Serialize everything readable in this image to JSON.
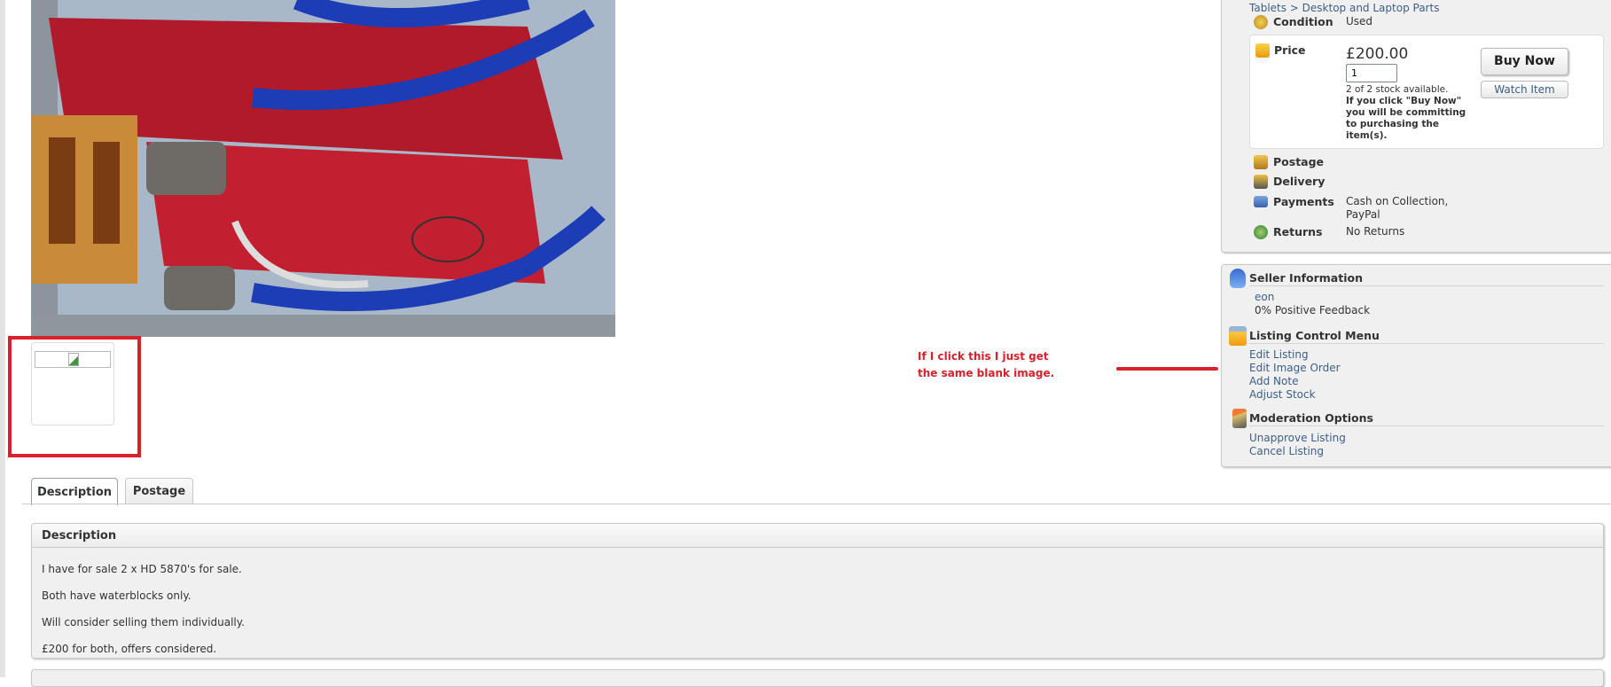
{
  "listing": {
    "breadcrumb_tail": "Tablets > Desktop and Laptop Parts",
    "condition_label": "Condition",
    "condition_value": "Used",
    "price_label": "Price",
    "price_value": "£200.00",
    "quantity_value": "1",
    "stock_text": "2 of 2 stock available.",
    "buy_warning": "If you click \"Buy Now\" you will be committing to purchasing the item(s).",
    "buy_now_label": "Buy Now",
    "watch_item_label": "Watch Item",
    "postage_label": "Postage",
    "delivery_label": "Delivery",
    "payments_label": "Payments",
    "payments_value_1": "Cash on Collection,",
    "payments_value_2": "PayPal",
    "returns_label": "Returns",
    "returns_value": "No Returns"
  },
  "seller": {
    "title": "Seller Information",
    "name": "eon",
    "feedback": "0% Positive Feedback"
  },
  "listing_control": {
    "title": "Listing Control Menu",
    "items": [
      "Edit Listing",
      "Edit Image Order",
      "Add Note",
      "Adjust Stock"
    ]
  },
  "moderation": {
    "title": "Moderation Options",
    "items": [
      "Unapprove Listing",
      "Cancel Listing"
    ]
  },
  "tabs": [
    {
      "label": "Description"
    },
    {
      "label": "Postage"
    }
  ],
  "description": {
    "title": "Description",
    "paragraphs": [
      "I have for sale 2 x HD 5870's for sale.",
      "Both have waterblocks only.",
      "Will consider selling them individually.",
      "£200 for both, offers considered."
    ]
  },
  "annotation": {
    "line1": "If I click this I just get",
    "line2": "the same blank image.",
    "color": "#d9202b"
  },
  "colors": {
    "link": "#3c5f86",
    "panel_bg": "#f0f0f0"
  }
}
